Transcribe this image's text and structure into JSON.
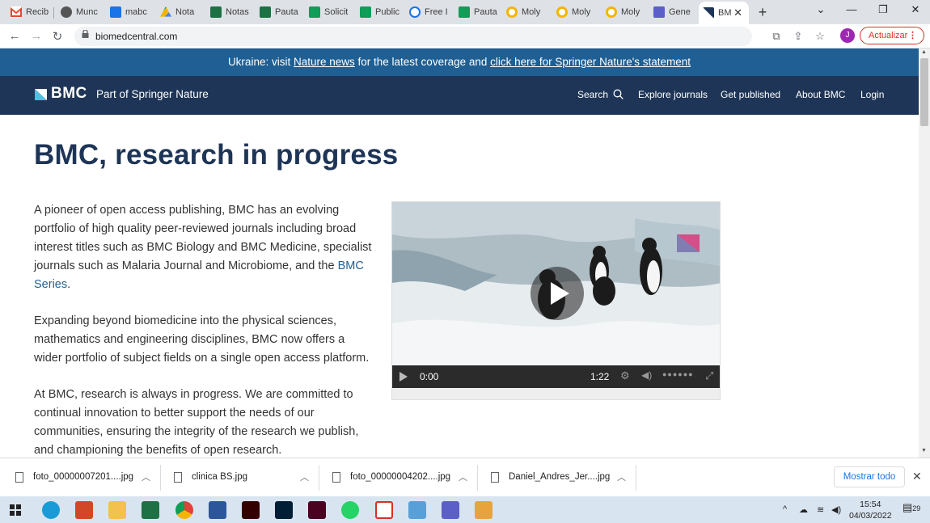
{
  "browser": {
    "tabs": [
      {
        "label": "Recib",
        "color": "#ffffff",
        "icon": "gmail-icon"
      },
      {
        "label": "Munc",
        "color": "#555555",
        "icon": "globe-icon"
      },
      {
        "label": "mabc",
        "color": "#1a73e8",
        "icon": "docs-icon"
      },
      {
        "label": "Nota",
        "color": "#0f9d58",
        "icon": "drive-icon"
      },
      {
        "label": "Notas",
        "color": "#1e7145",
        "icon": "excel-icon"
      },
      {
        "label": "Pauta",
        "color": "#1e7145",
        "icon": "excel-icon"
      },
      {
        "label": "Solicit",
        "color": "#0f9d58",
        "icon": "sheets-icon"
      },
      {
        "label": "Public",
        "color": "#0f9d58",
        "icon": "sheets-icon"
      },
      {
        "label": "Free I",
        "color": "#1a73e8",
        "icon": "gear-icon"
      },
      {
        "label": "Pauta",
        "color": "#0f9d58",
        "icon": "sheets-icon"
      },
      {
        "label": "Moly",
        "color": "#f4b400",
        "icon": "molymod-icon"
      },
      {
        "label": "Moly",
        "color": "#f4b400",
        "icon": "molymod-icon"
      },
      {
        "label": "Moly",
        "color": "#f4b400",
        "icon": "molymod-icon"
      },
      {
        "label": "Gene",
        "color": "#5b5fc7",
        "icon": "teams-icon"
      },
      {
        "label": "BM",
        "color": "#1e3557",
        "icon": "bmc-icon",
        "active": true
      }
    ],
    "new_tab": "+",
    "close_tab": "✕",
    "window": {
      "minimize": "—",
      "chevron": "⌄",
      "restore": "❐",
      "close": "✕"
    },
    "url": "biomedcentral.com",
    "profile_initial": "J",
    "update_label": "Actualizar"
  },
  "banner": {
    "prefix": "Ukraine: visit ",
    "link1": "Nature news",
    "middle": " for the latest coverage and ",
    "link2": "click here for Springer Nature's statement"
  },
  "header": {
    "logo": "BMC",
    "tagline": "Part of Springer Nature",
    "nav": {
      "search": "Search",
      "explore": "Explore journals",
      "get_published": "Get published",
      "about": "About BMC",
      "login": "Login"
    }
  },
  "main": {
    "title": "BMC, research in progress",
    "p1_before": "A pioneer of open access publishing, BMC has an evolving portfolio of high quality peer-reviewed journals including broad interest titles such as BMC Biology and BMC Medicine, specialist journals such as Malaria Journal and Microbiome, and the ",
    "p1_link": "BMC Series",
    "p1_after": ".",
    "p2": "Expanding beyond biomedicine into the physical sciences, mathematics and engineering disciplines, BMC now offers a wider portfolio of subject fields on a single open access platform.",
    "p3": "At BMC, research is always in progress. We are committed to continual innovation to better support the needs of our communities, ensuring the integrity of the research we publish, and championing the benefits of open research."
  },
  "video": {
    "current_time": "0:00",
    "duration": "1:22"
  },
  "downloads": {
    "items": [
      {
        "name": "foto_00000007201....jpg"
      },
      {
        "name": "clinica BS.jpg"
      },
      {
        "name": "foto_00000004202....jpg"
      },
      {
        "name": "Daniel_Andres_Jer....jpg"
      }
    ],
    "show_all": "Mostrar todo",
    "close": "✕"
  },
  "taskbar": {
    "apps": [
      {
        "icon": "edge-icon",
        "color": "#1a9bd7"
      },
      {
        "icon": "powerpoint-icon",
        "color": "#d24726"
      },
      {
        "icon": "file-explorer-icon",
        "color": "#f2c14e"
      },
      {
        "icon": "excel-icon",
        "color": "#1e7145"
      },
      {
        "icon": "chrome-icon",
        "color": "#db4437"
      },
      {
        "icon": "word-icon",
        "color": "#2b579a"
      },
      {
        "icon": "illustrator-icon",
        "color": "#330000"
      },
      {
        "icon": "photoshop-icon",
        "color": "#001e36"
      },
      {
        "icon": "indesign-icon",
        "color": "#49021f"
      },
      {
        "icon": "whatsapp-icon",
        "color": "#25d366"
      },
      {
        "icon": "acrobat-icon",
        "color": "#ffffff"
      },
      {
        "icon": "app-icon",
        "color": "#5aa0d8"
      },
      {
        "icon": "teams-icon",
        "color": "#5b5fc7"
      },
      {
        "icon": "paint-icon",
        "color": "#e8a33d"
      }
    ],
    "time": "15:54",
    "date": "04/03/2022",
    "notifications": "29"
  },
  "colors": {
    "banner": "#1f5f93",
    "header": "#1e3557",
    "title": "#1e3557",
    "link": "#1f5f93"
  }
}
